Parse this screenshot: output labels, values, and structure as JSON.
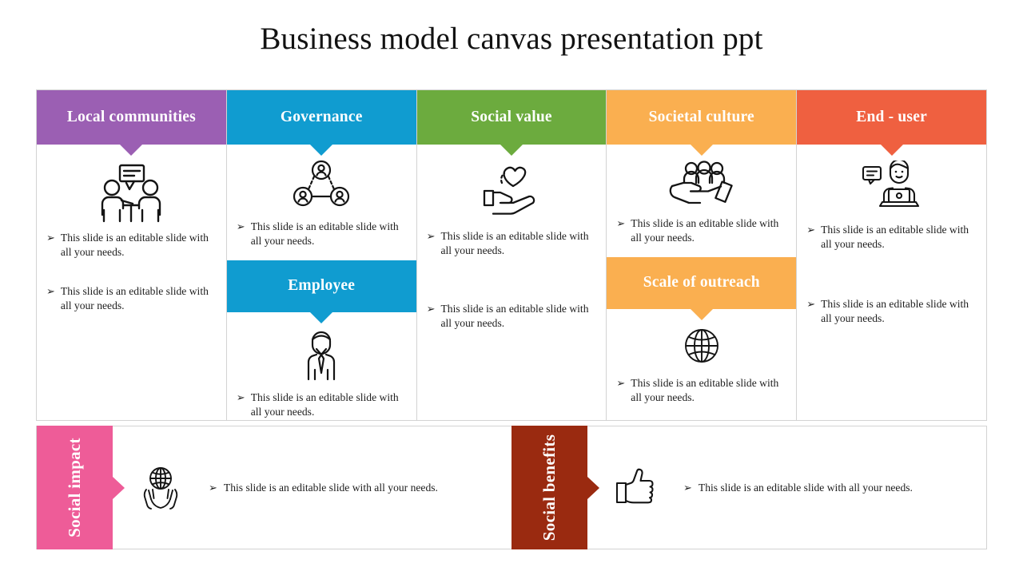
{
  "slide": {
    "title": "Business model canvas presentation ppt",
    "bullet_glyph": "➢"
  },
  "colors": {
    "purple": "#9B5FB3",
    "blue": "#109CD0",
    "green": "#6CAB3E",
    "orange": "#FAAF50",
    "redorange": "#EF6040",
    "pink": "#EE5C98",
    "darkred": "#9A2A10",
    "border": "#d3d3d3",
    "text": "#1d1d1d"
  },
  "columns": [
    {
      "header": "Local communities",
      "icon": "people-meeting-icon",
      "bullets": [
        "This slide is an editable slide with all your needs.",
        "This slide is an editable slide with all your needs."
      ]
    },
    {
      "header": "Governance",
      "icon": "org-network-icon",
      "bullets": [
        "This slide is an editable slide with all your needs."
      ],
      "sub_header": "Employee",
      "sub_icon": "employee-person-icon",
      "sub_bullets": [
        "This slide is an editable slide with all your needs."
      ]
    },
    {
      "header": "Social value",
      "icon": "hand-heart-icon",
      "bullets": [
        "This slide is an editable slide with all your needs.",
        "This slide is an editable slide with all your needs."
      ]
    },
    {
      "header": "Societal culture",
      "icon": "hand-people-icon",
      "bullets": [
        "This slide is an editable slide with all your needs."
      ],
      "sub_header": "Scale of outreach",
      "sub_icon": "globe-icon",
      "sub_bullets": [
        "This slide is an editable slide with all your needs."
      ]
    },
    {
      "header": "End - user",
      "icon": "user-laptop-chat-icon",
      "bullets": [
        "This slide is an editable slide with all your needs.",
        "This slide is an editable slide with all your needs."
      ]
    }
  ],
  "bottom": [
    {
      "label": "Social impact",
      "icon": "hands-globe-icon",
      "text": "This slide is an editable slide with all your needs."
    },
    {
      "label": "Social benefits",
      "icon": "thumbs-up-icon",
      "text": "This slide is an editable slide with all your needs."
    }
  ]
}
